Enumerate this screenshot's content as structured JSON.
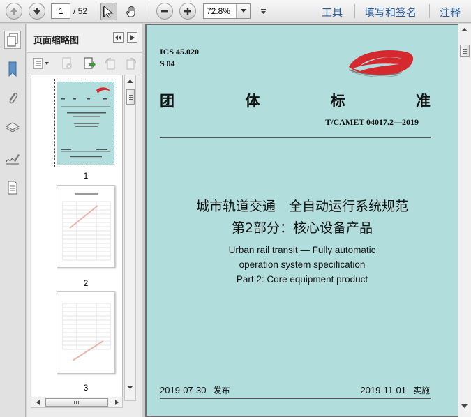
{
  "toolbar": {
    "page_current": "1",
    "page_total": "/ 52",
    "zoom": "72.8%",
    "tools_label": "工具",
    "sign_label": "填写和签名",
    "comment_label": "注释"
  },
  "thumbnails": {
    "title": "页面缩略图",
    "items": [
      {
        "label": "1"
      },
      {
        "label": "2"
      },
      {
        "label": "3"
      }
    ]
  },
  "document": {
    "ics_line": "ICS  45.020",
    "class_line": "S  04",
    "standard_title_chars": [
      "团",
      "体",
      "标",
      "准"
    ],
    "standard_number": "T/CAMET  04017.2—2019",
    "title_cn_line1": "城市轨道交通　全自动运行系统规范",
    "title_cn_line2": "第2部分：核心设备产品",
    "title_en_line1": "Urban rail transit — Fully automatic",
    "title_en_line2": "operation system specification",
    "title_en_line3": "Part 2: Core equipment product",
    "publish_date": "2019-07-30",
    "publish_label": "发布",
    "effective_date": "2019-11-01",
    "effective_label": "实施"
  },
  "colors": {
    "page_bg": "#b1dedd",
    "logo_red": "#d42a2f",
    "link_blue": "#2a5d9c"
  },
  "icons": [
    "arrow-up-icon",
    "arrow-down-icon",
    "select-arrow-icon",
    "hand-icon",
    "zoom-out-icon",
    "zoom-in-icon",
    "bookmark-icon",
    "paperclip-icon",
    "layers-icon",
    "signature-icon",
    "page-icon"
  ]
}
